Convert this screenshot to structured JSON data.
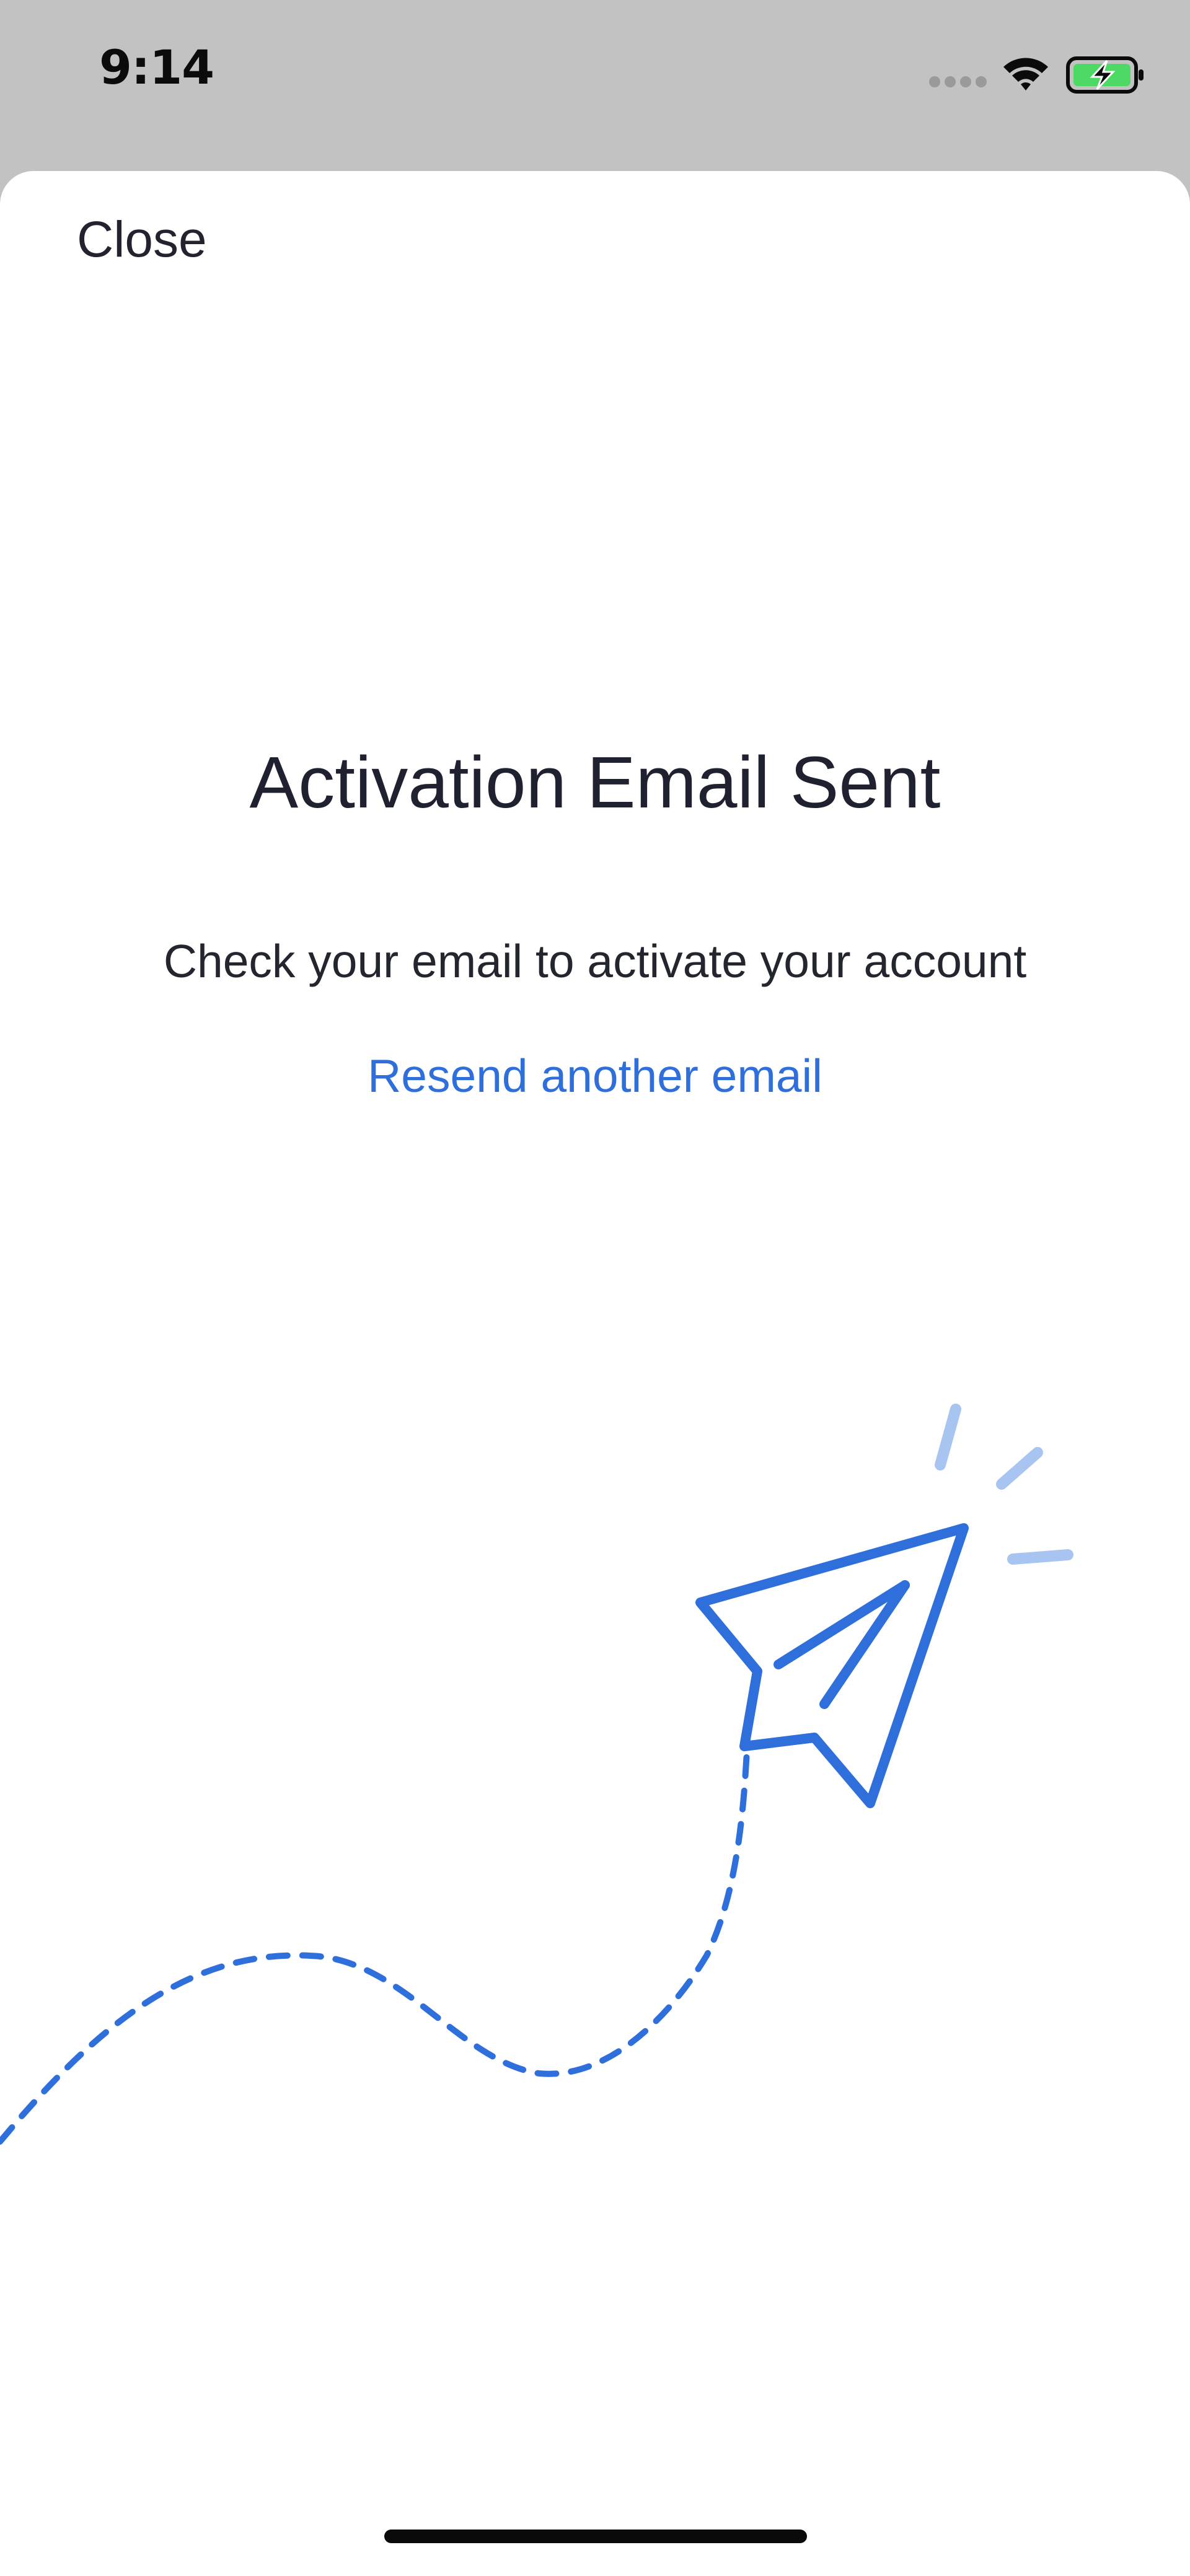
{
  "status_bar": {
    "time": "9:14",
    "icons": [
      "signal-dots-icon",
      "wifi-icon",
      "battery-charging-icon"
    ],
    "battery_color": "#4cd964"
  },
  "sheet": {
    "close_label": "Close",
    "title": "Activation Email Sent",
    "subtitle": "Check your email to activate your account",
    "resend_label": "Resend another email",
    "illustration": "paper-plane-icon",
    "accent_color": "#2f6fdc",
    "accent_light_color": "#a8c4f0"
  }
}
